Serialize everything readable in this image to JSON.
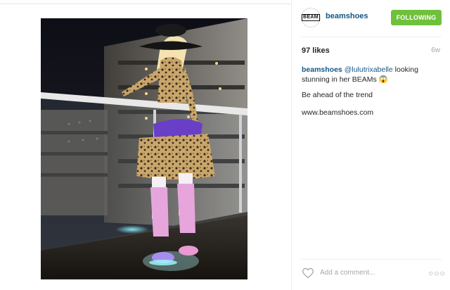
{
  "post": {
    "username": "beamshoes",
    "avatar_text": "BEAM",
    "follow_label": "FOLLOWING",
    "likes": "97 likes",
    "age": "6w",
    "caption": {
      "user": "beamshoes",
      "mention": "@lulutrixabelle",
      "text": "looking stunning in her BEAMs",
      "emoji": "😱"
    },
    "line2": "Be ahead of the trend",
    "line3": "www.beamshoes.com",
    "comment_placeholder": "Add a comment...",
    "more_label": "○○○"
  },
  "colors": {
    "accent": "#125688",
    "follow_green": "#6fc03a",
    "muted": "#a5a7aa"
  },
  "icons": [
    "heart-icon",
    "more-icon"
  ]
}
